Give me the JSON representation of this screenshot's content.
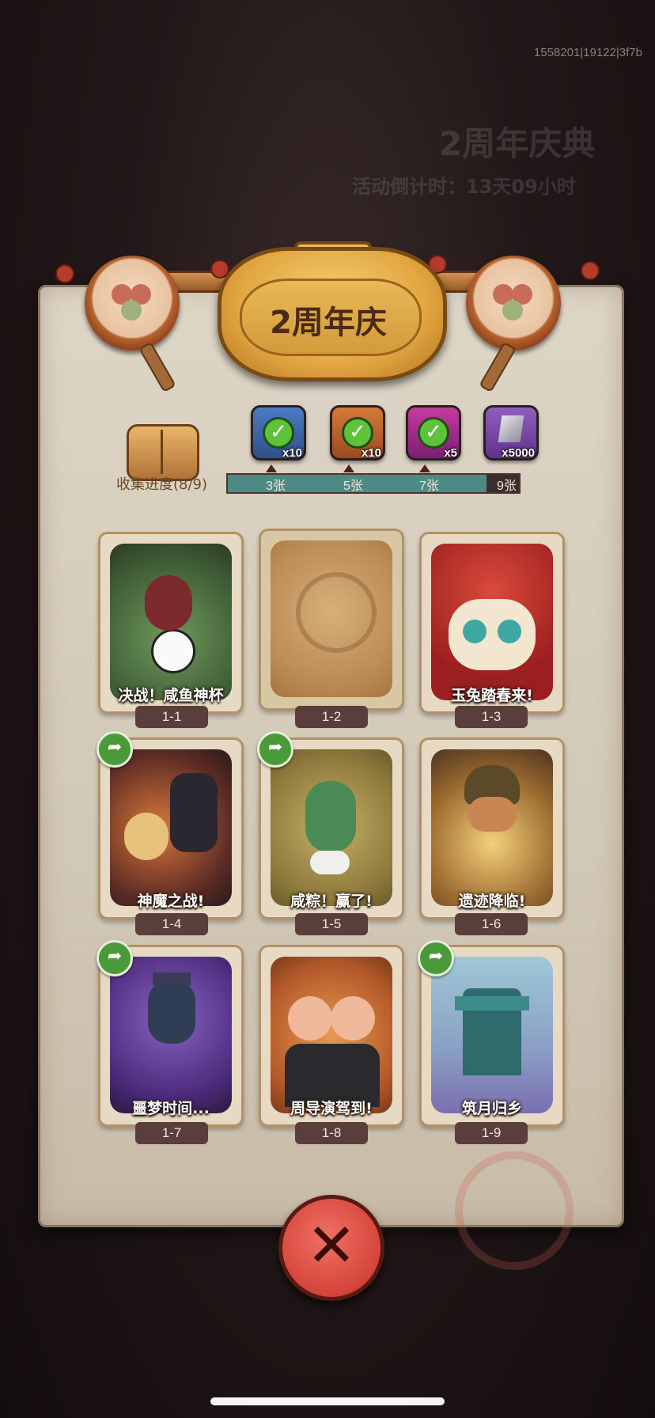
{
  "background": {
    "event_title": "2周年庆典",
    "countdown": "活动倒计时：13天09小时"
  },
  "build_id": "1558201|19122|3f7b",
  "plaque": {
    "title": "2周年庆"
  },
  "rewards": [
    {
      "icon": "treasure-chest-icon",
      "qty": "x10",
      "claimed": true
    },
    {
      "icon": "golden-key-icon",
      "qty": "x10",
      "claimed": true
    },
    {
      "icon": "purple-orb-icon",
      "qty": "x5",
      "claimed": true
    },
    {
      "icon": "stone-crystal-icon",
      "qty": "x5000",
      "claimed": false
    }
  ],
  "progress": {
    "label": "收集进度(8/9)",
    "collected": 8,
    "total": 9,
    "milestones": [
      "3张",
      "5张",
      "7张",
      "9张"
    ]
  },
  "cards": [
    {
      "title": "决战！咸鱼神杯",
      "num": "1-1",
      "share": false,
      "locked": false
    },
    {
      "title": "",
      "num": "1-2",
      "share": false,
      "locked": true
    },
    {
      "title": "玉兔踏春来!",
      "num": "1-3",
      "share": false,
      "locked": false
    },
    {
      "title": "神魔之战!",
      "num": "1-4",
      "share": true,
      "locked": false
    },
    {
      "title": "咸粽！赢了!",
      "num": "1-5",
      "share": true,
      "locked": false
    },
    {
      "title": "遗迹降临!",
      "num": "1-6",
      "share": false,
      "locked": false
    },
    {
      "title": "噩梦时间...",
      "num": "1-7",
      "share": true,
      "locked": false
    },
    {
      "title": "周导演驾到!",
      "num": "1-8",
      "share": false,
      "locked": false
    },
    {
      "title": "筑月归乡",
      "num": "1-9",
      "share": true,
      "locked": false
    }
  ],
  "colors": {
    "progress_fill": "#4d8a84",
    "card_number_bg": "#5a3e3c",
    "close_button": "#d4453a",
    "share_button": "#4a9a3a"
  }
}
